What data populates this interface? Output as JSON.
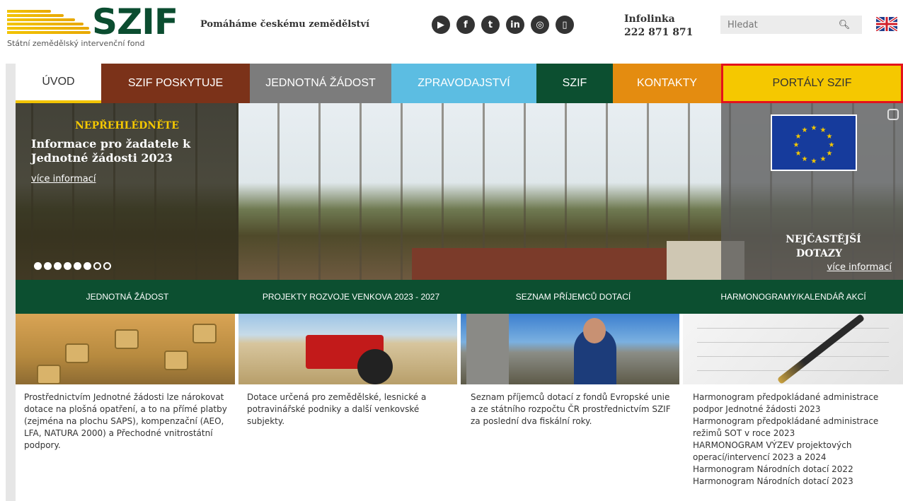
{
  "header": {
    "logo_text": "SZIF",
    "logo_subtitle": "Státní zemědělský intervenční fond",
    "tagline": "Pomáháme českému zemědělství",
    "social_icons": [
      "youtube-icon",
      "facebook-icon",
      "twitter-icon",
      "linkedin-icon",
      "instagram-icon",
      "mobile-icon"
    ],
    "infolink_label": "Infolinka",
    "infolink_number": "222 871 871",
    "search_placeholder": "Hledat"
  },
  "nav": {
    "items": [
      {
        "label": "ÚVOD"
      },
      {
        "label": "SZIF POSKYTUJE"
      },
      {
        "label": "JEDNOTNÁ ŽÁDOST"
      },
      {
        "label": "ZPRAVODAJSTVÍ"
      },
      {
        "label": "SZIF"
      },
      {
        "label": "KONTAKTY"
      },
      {
        "label": "PORTÁLY SZIF"
      }
    ]
  },
  "hero": {
    "kicker": "NEPŘEHLÉDNĚTE",
    "title": "Informace pro žadatele k Jednotné žádosti 2023",
    "more_left": "více informací",
    "faq_line1": "NEJČASTĚJŠÍ",
    "faq_line2": "DOTAZY",
    "more_right": "více informací",
    "slides_total": 8,
    "slides_active": 6
  },
  "green_bar": {
    "links": [
      "JEDNOTNÁ ŽÁDOST",
      "PROJEKTY ROZVOJE VENKOVA 2023 - 2027",
      "SEZNAM PŘÍJEMCŮ DOTACÍ",
      "HARMONOGRAMY/KALENDÁŘ AKCÍ"
    ]
  },
  "columns": {
    "col1": "Prostřednictvím Jednotné žádosti lze nárokovat dotace na plošná opatření, a to na přímé platby (zejména na plochu SAPS), kompenzační (AEO, LFA, NATURA 2000) a Přechodné vnitrostátní podpory.",
    "col2": "Dotace určená pro zemědělské, lesnické a potravinářské podniky a další venkovské subjekty.",
    "col3": "Seznam příjemců dotací z fondů Evropské unie a ze státního rozpočtu ČR prostřednictvím SZIF za poslední dva fiskální roky.",
    "col4": [
      "Harmonogram předpokládané administrace",
      "podpor Jednotné žádosti 2023",
      "Harmonogram předpokládané administrace",
      "režimů SOT v roce 2023",
      "HARMONOGRAM VÝZEV projektových",
      "operací/intervencí 2023 a 2024",
      "Harmonogram Národních dotací 2022",
      "Harmonogram Národních dotací 2023"
    ]
  },
  "colors": {
    "brand_green": "#0c4f30",
    "brand_yellow": "#f5c800",
    "highlight_red": "#e4121b"
  }
}
